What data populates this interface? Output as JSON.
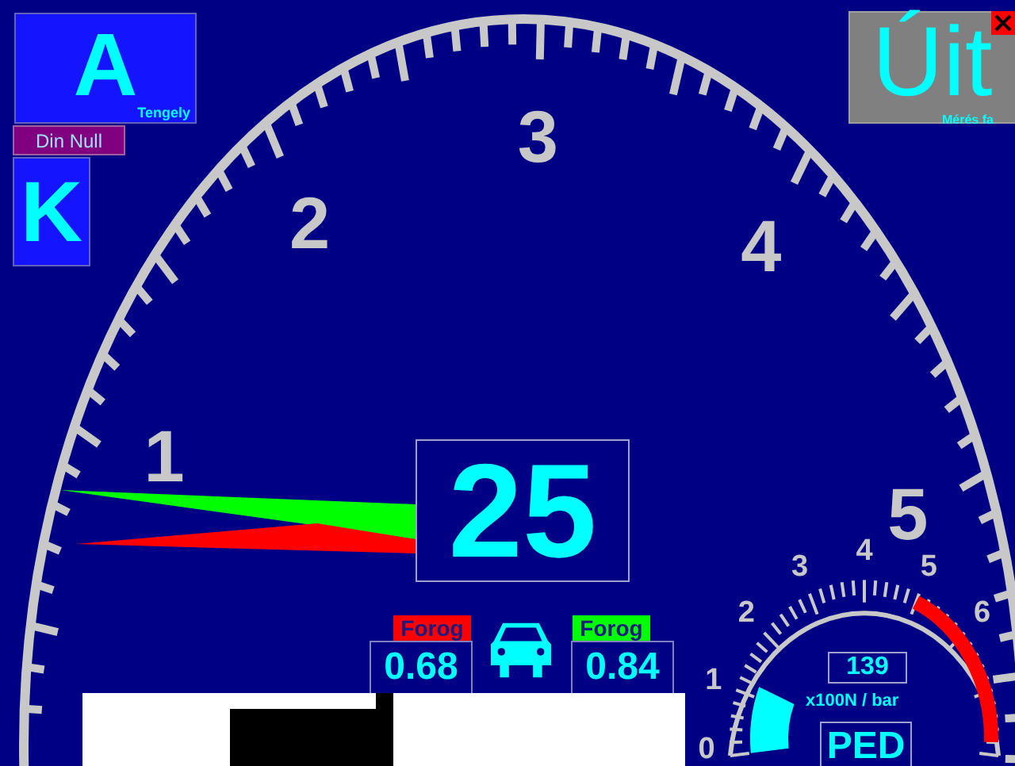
{
  "mode_button": {
    "letter": "A",
    "caption": "Tengely"
  },
  "din_null_button": {
    "label": "Din Null"
  },
  "k_button": {
    "label": "K"
  },
  "exit_button": {
    "label": "Úit",
    "caption": "Mérés fa"
  },
  "main_gauge": {
    "scale_labels": [
      "1",
      "2",
      "3",
      "4",
      "5"
    ],
    "digital_value": "25"
  },
  "indicators": [
    {
      "label": "Forog",
      "color": "#ff0000",
      "value": "0.68"
    },
    {
      "label": "Forog",
      "color": "#00ff00",
      "value": "0.84"
    }
  ],
  "pedal_gauge": {
    "scale_labels": [
      "0",
      "1",
      "2",
      "3",
      "4",
      "5",
      "6"
    ],
    "value": "139",
    "unit": "x100N / bar",
    "mode": "PED",
    "level": 0.15
  }
}
